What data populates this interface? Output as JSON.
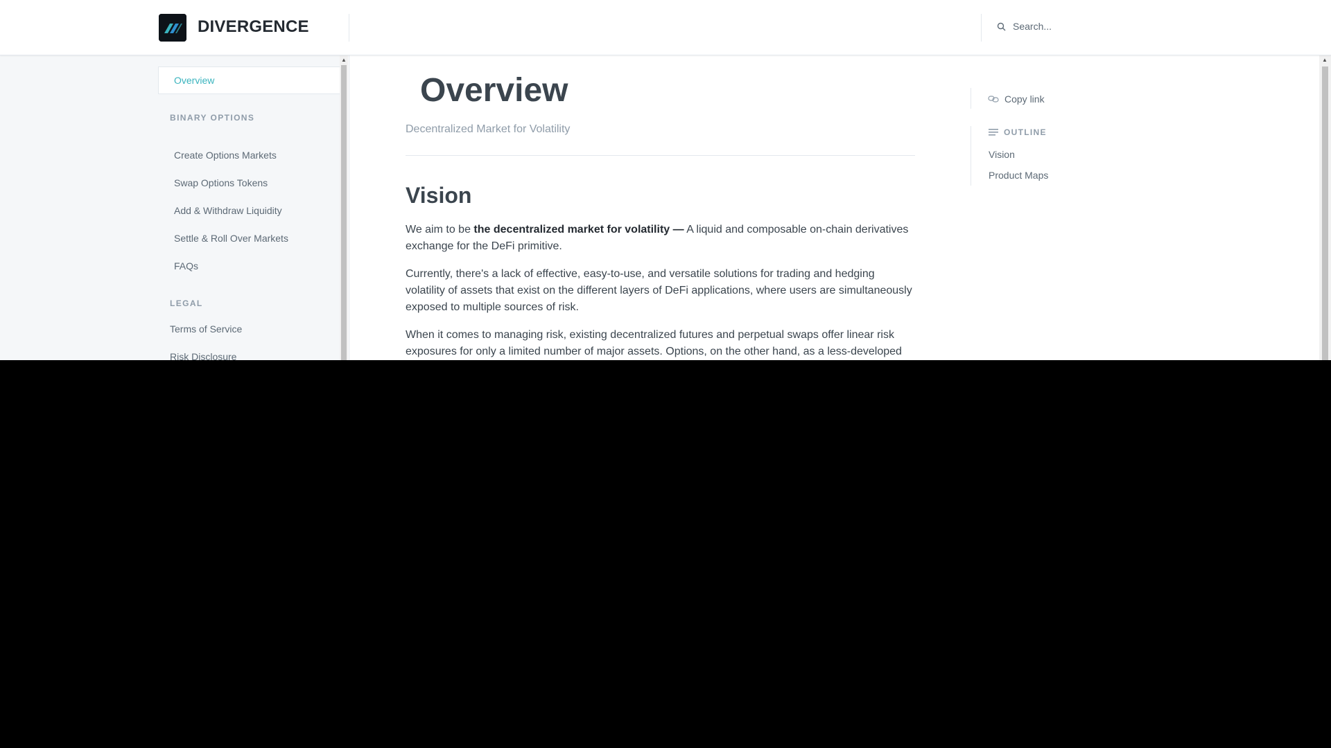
{
  "header": {
    "brand": "DIVERGENCE",
    "search_placeholder": "Search..."
  },
  "sidebar": {
    "active_item": "Overview",
    "sections": [
      {
        "heading": "BINARY OPTIONS",
        "items": [
          "Create Options Markets",
          "Swap Options Tokens",
          "Add & Withdraw Liquidity",
          "Settle & Roll Over Markets",
          "FAQs"
        ]
      },
      {
        "heading": "LEGAL",
        "items": [
          "Terms of Service",
          "Risk Disclosure"
        ]
      }
    ]
  },
  "main": {
    "title": "Overview",
    "subtitle": "Decentralized Market for Volatility",
    "section_heading": "Vision",
    "para1_prefix": "We aim to be ",
    "para1_bold": "the decentralized market for volatility —",
    "para1_suffix": " A liquid and composable on-chain derivatives exchange for the DeFi primitive.",
    "para2": "Currently, there's a lack of effective, easy-to-use, and versatile solutions for trading and hedging volatility of assets that exist on the different layers of DeFi applications, where users are simultaneously exposed to multiple sources of risk.",
    "para3": "When it comes to managing risk, existing decentralized futures and perpetual swaps offer linear risk exposures for only a limited number of major assets. Options, on the other hand, as a less-developed"
  },
  "rail": {
    "copy_link": "Copy link",
    "outline_heading": "OUTLINE",
    "outline_items": [
      "Vision",
      "Product Maps"
    ]
  },
  "colors": {
    "accent": "#3ab4be",
    "sidebar_bg": "#f5f7f9",
    "text": "#3b454e",
    "muted": "#8f9ca9"
  },
  "icons": {
    "logo": "divergence-logo",
    "search": "search-icon",
    "copy": "link-icon",
    "outline": "list-icon"
  }
}
